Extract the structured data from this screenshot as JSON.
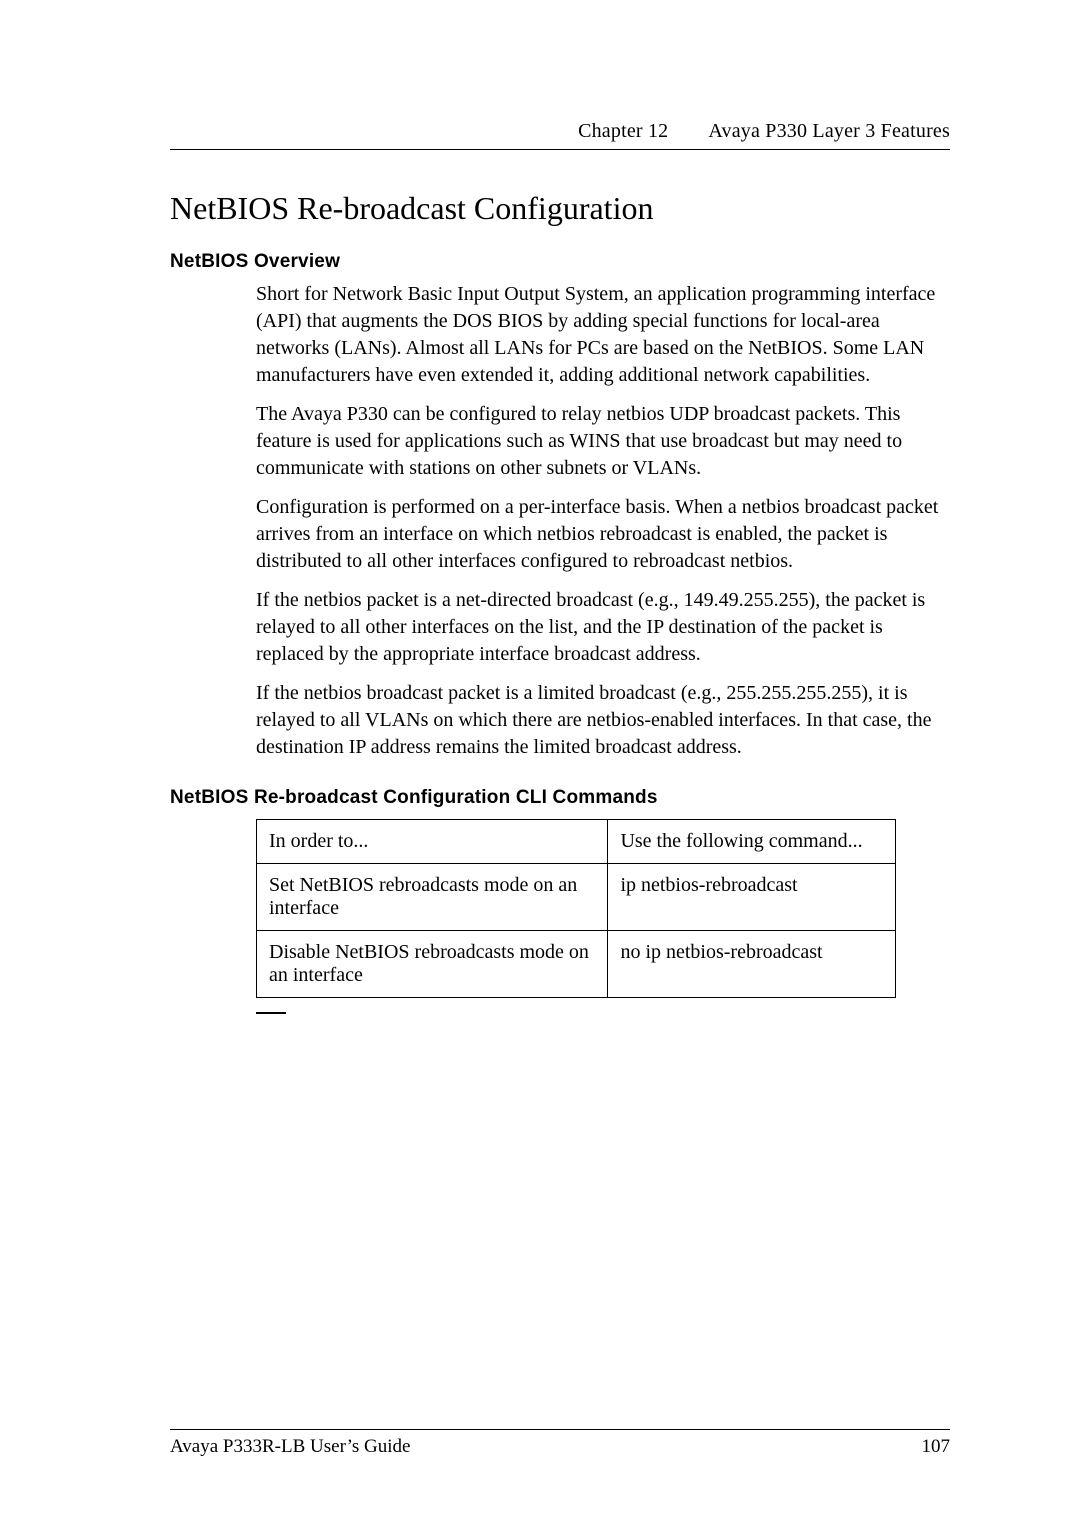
{
  "header": {
    "chapter": "Chapter 12",
    "title": "Avaya P330 Layer 3 Features"
  },
  "section_title": "NetBIOS Re-broadcast Configuration",
  "overview": {
    "heading": "NetBIOS Overview",
    "p1": "Short for Network Basic Input Output System, an application programming interface (API) that augments the DOS BIOS by adding special functions for local-area networks (LANs). Almost all LANs for PCs are based on the NetBIOS. Some LAN manufacturers have even extended it, adding additional network capabilities.",
    "p2": "The Avaya P330 can be configured to relay netbios UDP broadcast packets. This feature is used for applications such as WINS that use broadcast but may need to communicate with stations on other subnets or VLANs.",
    "p3": "Configuration is performed on a per-interface basis. When a netbios broadcast packet arrives from an interface on which netbios rebroadcast is enabled, the packet is distributed to all other interfaces configured to rebroadcast netbios.",
    "p4": "If the netbios packet is a net-directed broadcast (e.g., 149.49.255.255), the packet is relayed to all other interfaces on the list, and the IP destination of the packet is replaced by the appropriate interface broadcast address.",
    "p5": "If the netbios broadcast packet is a limited broadcast (e.g., 255.255.255.255), it is relayed to all VLANs on which there are netbios-enabled interfaces. In that case, the destination IP address remains the limited broadcast address."
  },
  "cli": {
    "heading": "NetBIOS Re-broadcast Configuration CLI Commands",
    "header_left": "In order to...",
    "header_right": "Use the following command...",
    "rows": [
      {
        "left": "Set NetBIOS rebroadcasts mode on an interface",
        "right": "ip netbios-rebroadcast"
      },
      {
        "left": "Disable NetBIOS rebroadcasts mode on an interface",
        "right": "no ip netbios-rebroadcast"
      }
    ]
  },
  "footer": {
    "left": "Avaya P333R-LB User’s Guide",
    "right": "107"
  }
}
